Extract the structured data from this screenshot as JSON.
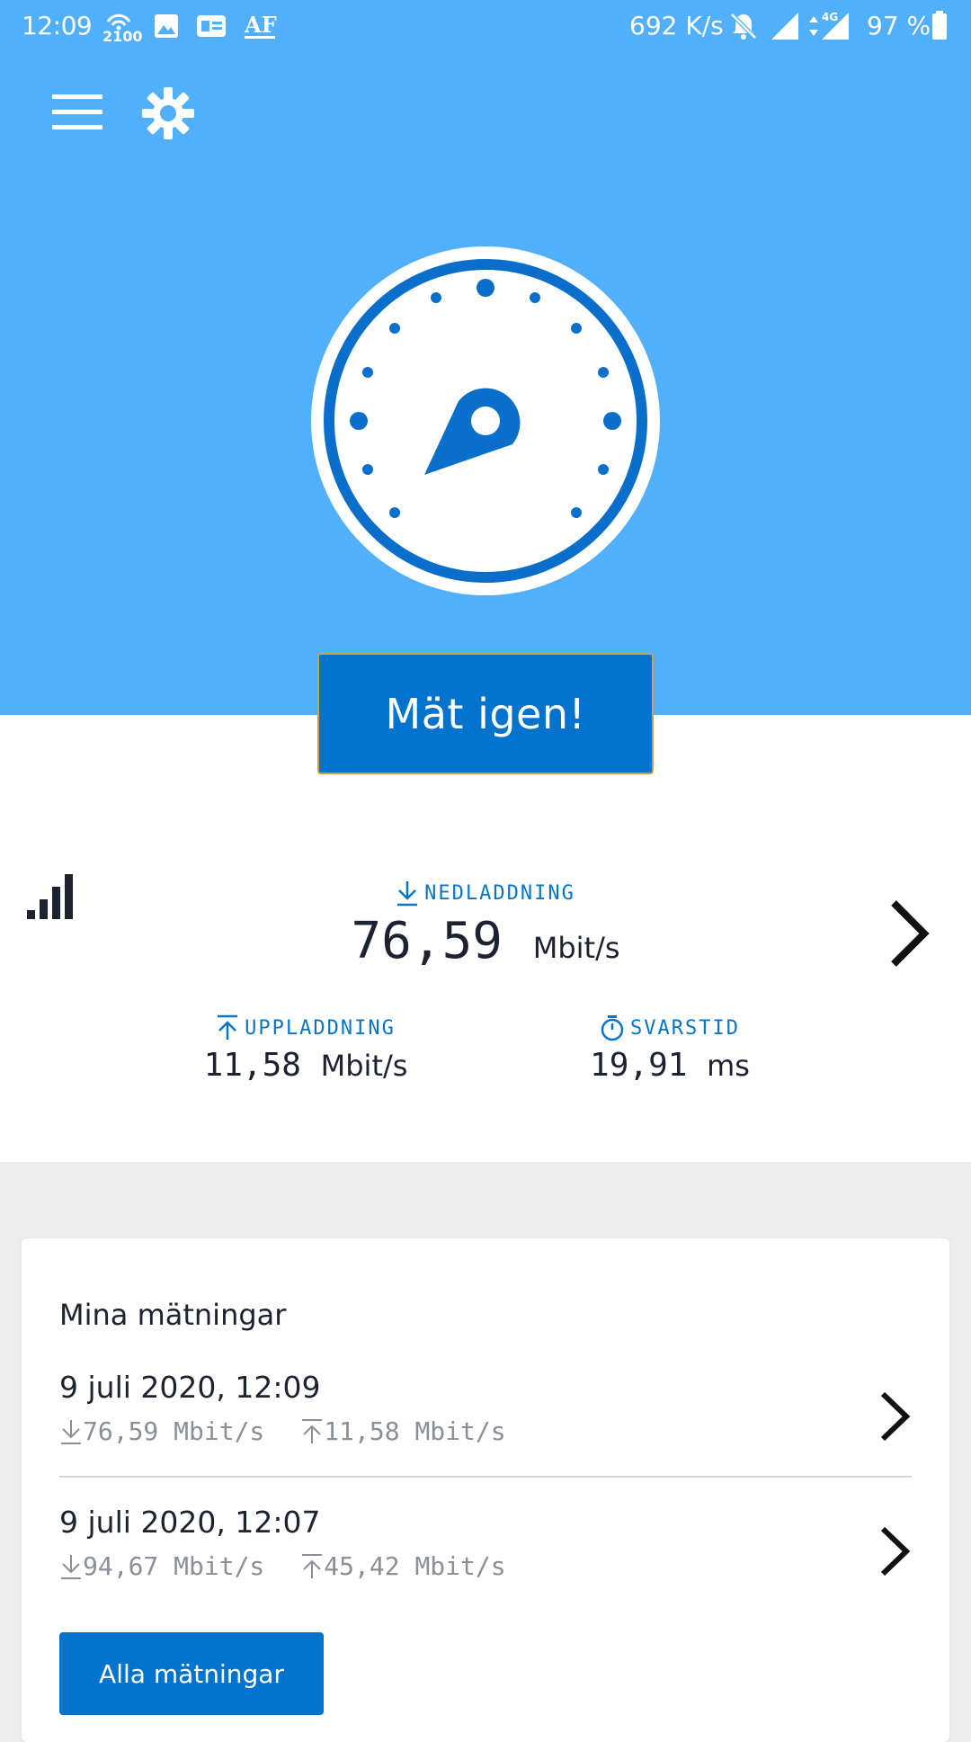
{
  "status_bar": {
    "time": "12:09",
    "network_badge": "2100",
    "speed": "692 K/s",
    "network_type": "4G",
    "battery": "97 %",
    "icons": [
      "wifi-hotspot-icon",
      "gallery-icon",
      "news-icon",
      "af-icon",
      "bell-muted-icon",
      "signal-icon",
      "data-arrows-icon",
      "battery-icon"
    ]
  },
  "toolbar": {
    "menu_icon": "menu-icon",
    "settings_icon": "gear-icon"
  },
  "gauge": {
    "icon": "speedometer-icon",
    "colors": {
      "ring": "#0a6fcb",
      "face": "#ffffff",
      "hero_bg": "#52b0fb"
    }
  },
  "actions": {
    "measure_again": "Mät igen!",
    "all_measurements": "Alla mätningar"
  },
  "results": {
    "download": {
      "label": "NEDLADDNING",
      "value": "76,59",
      "unit": "Mbit/s"
    },
    "upload": {
      "label": "UPPLADDNING",
      "value": "11,58",
      "unit": "Mbit/s"
    },
    "latency": {
      "label": "SVARSTID",
      "value": "19,91",
      "unit": "ms"
    }
  },
  "history": {
    "title": "Mina mätningar",
    "rows": [
      {
        "date": "9 juli 2020, 12:09",
        "download": "76,59 Mbit/s",
        "upload": "11,58 Mbit/s"
      },
      {
        "date": "9 juli 2020, 12:07",
        "download": "94,67 Mbit/s",
        "upload": "45,42 Mbit/s"
      }
    ]
  },
  "colors": {
    "accent": "#0473cd",
    "label_blue": "#0a75c8",
    "text": "#1d2230",
    "muted": "#8a8f98"
  }
}
